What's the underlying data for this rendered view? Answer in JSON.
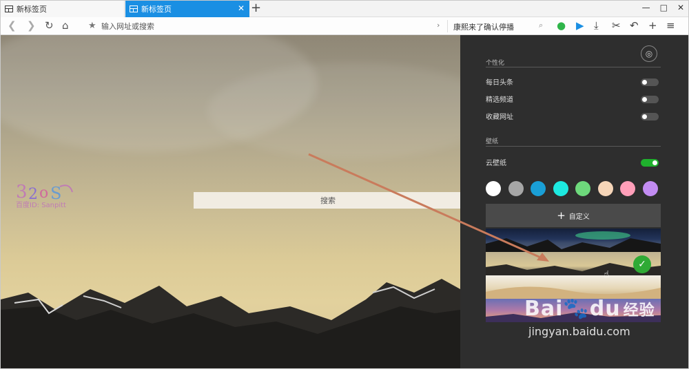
{
  "tabs": [
    {
      "label": "新标签页",
      "active": false
    },
    {
      "label": "新标签页",
      "active": true
    }
  ],
  "new_tab_symbol": "+",
  "window_controls": [
    "—",
    "□",
    "✕"
  ],
  "address_bar": {
    "placeholder": "输入网址或搜索",
    "hot_search": "康熙来了确认停播"
  },
  "nav_icons": [
    "back-icon",
    "forward-icon",
    "refresh-icon",
    "home-icon",
    "star-icon"
  ],
  "toolbar_icons": [
    "wechat-icon",
    "play-icon",
    "download-icon",
    "scissors-icon",
    "undo-icon",
    "add-icon",
    "menu-icon"
  ],
  "search_box": {
    "label": "搜索"
  },
  "watermark": {
    "text": "百度ID: Sanpitt"
  },
  "settings": {
    "personalize": {
      "title": "个性化",
      "items": [
        {
          "label": "每日头条",
          "on": false
        },
        {
          "label": "精选频道",
          "on": false
        },
        {
          "label": "收藏网址",
          "on": false
        }
      ]
    },
    "wallpaper": {
      "title": "壁纸",
      "cloud_label": "云壁纸",
      "cloud_on": true,
      "colors": [
        "#ffffff",
        "#a6a6a6",
        "#1a9fd6",
        "#1de9e0",
        "#6ed97c",
        "#f5d5b8",
        "#ff9fb9",
        "#c28cf2"
      ],
      "custom_label": "自定义",
      "selected_index": 1
    }
  },
  "baidu_watermark": {
    "brand": "Bai",
    "brand2": "du",
    "jy": "经验",
    "url": "jingyan.baidu.com"
  },
  "colors": {
    "tab_active": "#1a8fe3",
    "panel_bg": "#2e2e2e",
    "toggle_on": "#1fb12d",
    "check": "#2faa35"
  }
}
